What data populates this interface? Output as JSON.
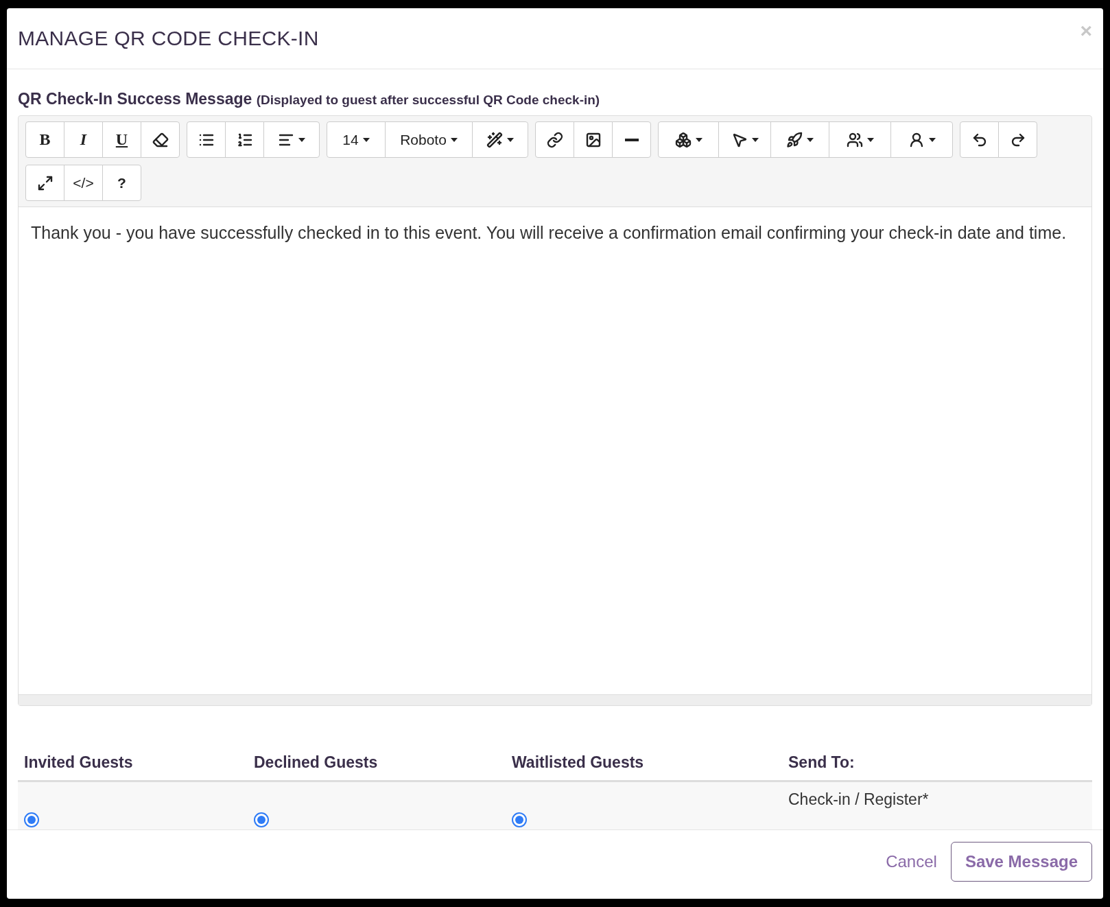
{
  "dialog": {
    "title": "MANAGE QR CODE CHECK-IN",
    "close": "×"
  },
  "message_label": {
    "title": "QR Check-In Success Message",
    "hint": "(Displayed to guest after successful QR Code check-in)"
  },
  "toolbar": {
    "bold": "B",
    "italic": "I",
    "underline": "U",
    "font_size": "14",
    "font_name": "Roboto",
    "code_view": "</>",
    "help": "?"
  },
  "editor": {
    "content": "Thank you - you have successfully checked in to this event. You will receive a confirmation email confirming your check-in date and time."
  },
  "table": {
    "columns": [
      "Invited Guests",
      "Declined Guests",
      "Waitlisted Guests",
      "Send To:"
    ],
    "rows": [
      {
        "radios": [
          {
            "selected": true
          },
          {
            "selected": true
          },
          {
            "selected": true
          }
        ],
        "send_to": "Check-in / Register*"
      }
    ]
  },
  "footer": {
    "cancel": "Cancel",
    "save": "Save Message"
  }
}
